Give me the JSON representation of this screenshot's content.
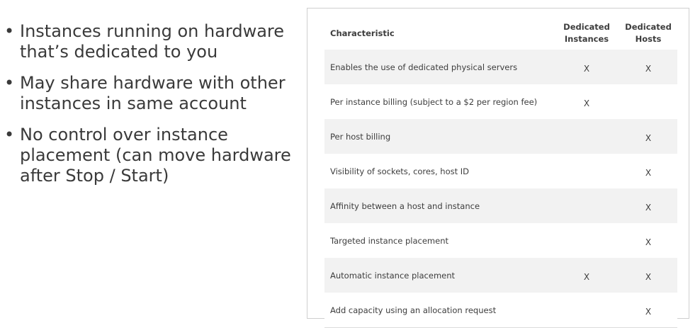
{
  "bullets": [
    "Instances running on hardware that’s dedicated to you",
    "May share hardware with other instances in same account",
    "No control over instance placement (can move hardware after Stop / Start)"
  ],
  "bullet_glyph": "•",
  "table": {
    "headers": {
      "characteristic": "Characteristic",
      "dedicated_instances_line1": "Dedicated",
      "dedicated_instances_line2": "Instances",
      "dedicated_hosts_line1": "Dedicated",
      "dedicated_hosts_line2": "Hosts"
    },
    "rows": [
      {
        "label": "Enables the use of dedicated physical servers",
        "instances": "X",
        "hosts": "X"
      },
      {
        "label": "Per instance billing (subject to a $2 per region fee)",
        "instances": "X",
        "hosts": ""
      },
      {
        "label": "Per host billing",
        "instances": "",
        "hosts": "X"
      },
      {
        "label": "Visibility of sockets, cores, host ID",
        "instances": "",
        "hosts": "X"
      },
      {
        "label": "Affinity between a host and instance",
        "instances": "",
        "hosts": "X"
      },
      {
        "label": "Targeted instance placement",
        "instances": "",
        "hosts": "X"
      },
      {
        "label": "Automatic instance placement",
        "instances": "X",
        "hosts": "X"
      },
      {
        "label": "Add capacity using an allocation request",
        "instances": "",
        "hosts": "X"
      }
    ]
  }
}
